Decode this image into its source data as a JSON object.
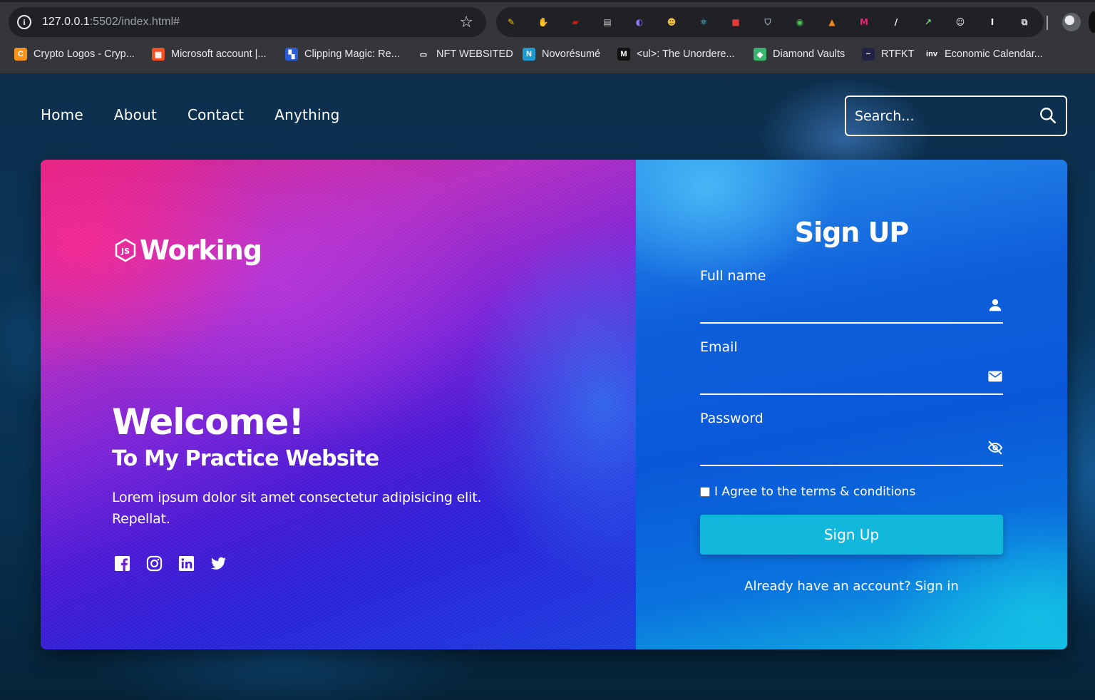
{
  "browser": {
    "url_host": "127.0.0.1",
    "url_rest": ":5502/index.html#",
    "extensions": [
      {
        "name": "pencil-ext-icon",
        "color": "#f4c20d",
        "glyph": "✎"
      },
      {
        "name": "stop-hand-ext-icon",
        "color": "#e02020",
        "glyph": "✋"
      },
      {
        "name": "red-pen-ext-icon",
        "color": "#d01818",
        "glyph": "▰"
      },
      {
        "name": "window-ext-icon",
        "color": "#c8c8c8",
        "glyph": "▤"
      },
      {
        "name": "ghost-ext-icon",
        "color": "#8b7cf6",
        "glyph": "◐"
      },
      {
        "name": "face-ext-icon",
        "color": "#f5c542",
        "glyph": "☻"
      },
      {
        "name": "react-ext-icon",
        "color": "#61dafb",
        "glyph": "⚛"
      },
      {
        "name": "bag-ext-icon",
        "color": "#e53935",
        "glyph": "■"
      },
      {
        "name": "shield-ext-icon",
        "color": "#9aa7b5",
        "glyph": "⛉"
      },
      {
        "name": "frog-ext-icon",
        "color": "#49c74f",
        "glyph": "◉"
      },
      {
        "name": "metamask-ext-icon",
        "color": "#f6851b",
        "glyph": "▲"
      },
      {
        "name": "me-ext-icon",
        "color": "#e42575",
        "glyph": "M"
      },
      {
        "name": "slash-ext-icon",
        "color": "#ffffff",
        "glyph": "/"
      },
      {
        "name": "chart-ext-icon",
        "color": "#7bd389",
        "glyph": "↗"
      },
      {
        "name": "smiley-ext-icon",
        "color": "#ffffff",
        "glyph": "☺"
      },
      {
        "name": "i-ext-icon",
        "color": "#ffffff",
        "glyph": "I"
      },
      {
        "name": "puzzle-ext-icon",
        "color": "#e8eaed",
        "glyph": "⧉"
      }
    ],
    "bookmarks": [
      {
        "label": "Crypto Logos - Cryp...",
        "color": "#f7931a",
        "glyph": "C"
      },
      {
        "label": "Microsoft account |...",
        "color": "#f25022",
        "glyph": "▦"
      },
      {
        "label": "Clipping Magic: Re...",
        "color": "#2b5cd8",
        "glyph": "▚"
      },
      {
        "label": "NFT WEBSITED",
        "color": "#35363a",
        "glyph": "▭"
      },
      {
        "label": "Novorésumé",
        "color": "#1f9bd1",
        "glyph": "N"
      },
      {
        "label": "<ul>: The Unordere...",
        "color": "#111111",
        "glyph": "M"
      },
      {
        "label": "Diamond Vaults",
        "color": "#3ab56f",
        "glyph": "◆"
      },
      {
        "label": "RTFKT",
        "color": "#222244",
        "glyph": "~"
      },
      {
        "label": "Economic Calendar...",
        "color": "#35363a",
        "glyph": "inv"
      }
    ]
  },
  "nav": {
    "items": [
      "Home",
      "About",
      "Contact",
      "Anything"
    ]
  },
  "search": {
    "placeholder": "Search..."
  },
  "hero": {
    "logo_text": "Working",
    "welcome": "Welcome!",
    "subtitle": "To My Practice Website",
    "paragraph": "Lorem ipsum dolor sit amet consectetur adipisicing elit. Repellat.",
    "socials": [
      "facebook-icon",
      "instagram-icon",
      "linkedin-icon",
      "twitter-icon"
    ]
  },
  "form": {
    "title": "Sign UP",
    "fullname_label": "Full name",
    "email_label": "Email",
    "password_label": "Password",
    "agree_label": "I Agree to the terms & conditions",
    "submit_label": "Sign Up",
    "already_text": "Already have an account?",
    "signin_label": "Sign in"
  },
  "colors": {
    "button": "#12b8dc",
    "page_bg": "#0b2a45"
  }
}
